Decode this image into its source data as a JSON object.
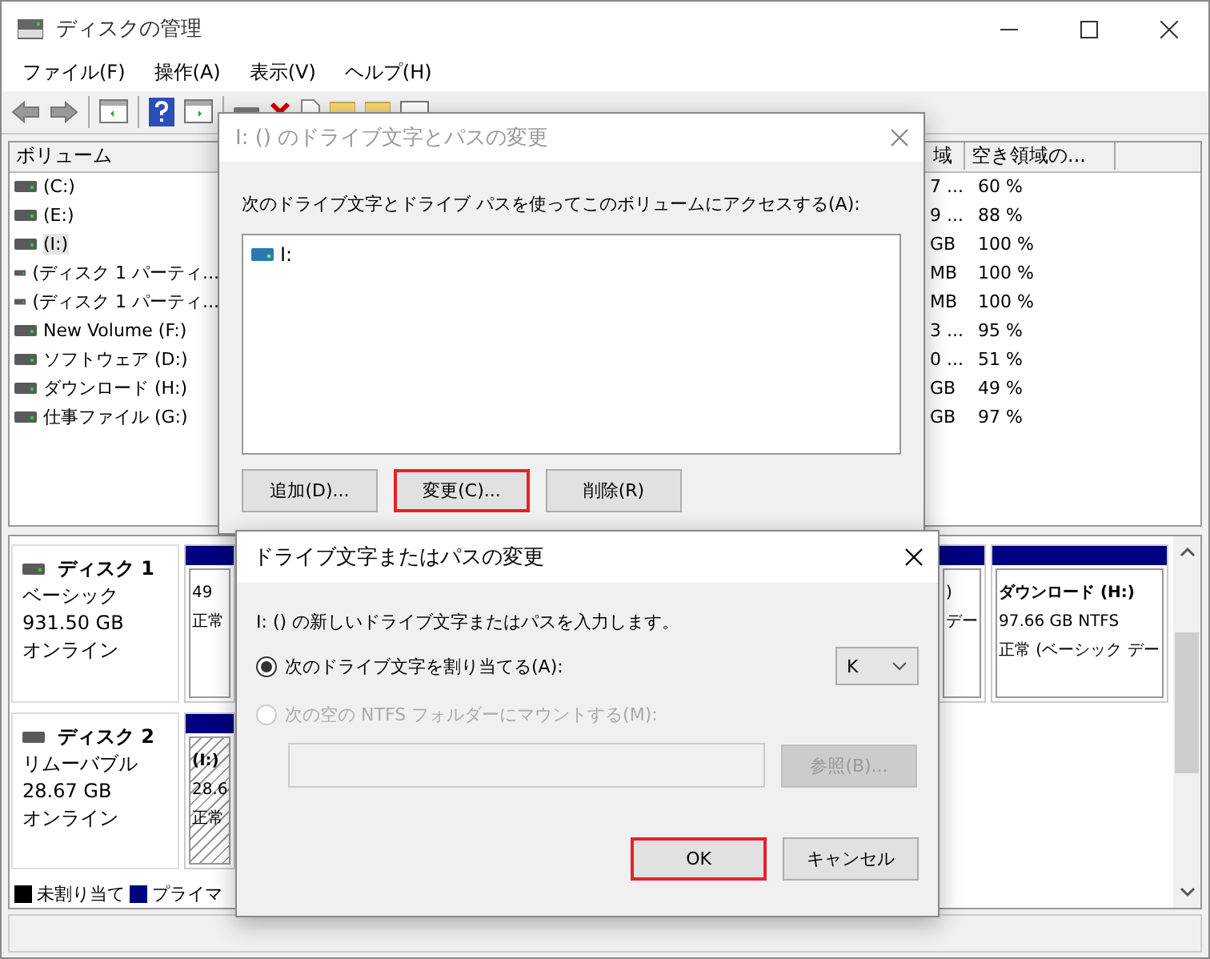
{
  "window": {
    "title": "ディスクの管理"
  },
  "menu": [
    {
      "label": "ファイル(F)"
    },
    {
      "label": "操作(A)"
    },
    {
      "label": "表示(V)"
    },
    {
      "label": "ヘルプ(H)"
    }
  ],
  "volume_table": {
    "columns": [
      {
        "label": "ボリューム"
      },
      {
        "label": "域"
      },
      {
        "label": "空き領域の..."
      }
    ],
    "rows": [
      {
        "volume": "(C:)",
        "column_2": "7 ...",
        "free": "60 %",
        "selected": false
      },
      {
        "volume": "(E:)",
        "column_2": "9 ...",
        "free": "88 %",
        "selected": false
      },
      {
        "volume": "(I:)",
        "column_2": "GB",
        "free": "100 %",
        "selected": true
      },
      {
        "volume": "(ディスク 1 パーティ...",
        "column_2": "MB",
        "free": "100 %",
        "selected": false
      },
      {
        "volume": "(ディスク 1 パーティ...",
        "column_2": "MB",
        "free": "100 %",
        "selected": false
      },
      {
        "volume": "New Volume (F:)",
        "column_2": "3 ...",
        "free": "95 %",
        "selected": false
      },
      {
        "volume": "ソフトウェア (D:)",
        "column_2": "0 ...",
        "free": "51 %",
        "selected": false
      },
      {
        "volume": "ダウンロード (H:)",
        "column_2": "GB",
        "free": "49 %",
        "selected": false
      },
      {
        "volume": "仕事ファイル (G:)",
        "column_2": "GB",
        "free": "97 %",
        "selected": false
      }
    ]
  },
  "disks": [
    {
      "name": "ディスク 1",
      "type": "ベーシック",
      "size": "931.50 GB",
      "status": "オンライン",
      "partitions": [
        {
          "lines": [
            "49",
            "正常"
          ],
          "selected": false
        },
        {
          "lines": [
            ")",
            "デー"
          ],
          "selected": false
        },
        {
          "title": "ダウンロード (H:)",
          "lines": [
            "97.66 GB NTFS",
            "正常 (ベーシック デー"
          ],
          "selected": false
        }
      ]
    },
    {
      "name": "ディスク 2",
      "type": "リムーバブル",
      "size": "28.67 GB",
      "status": "オンライン",
      "partitions": [
        {
          "title": "(I:)",
          "lines": [
            "28.6",
            "正常"
          ],
          "selected": true
        }
      ]
    }
  ],
  "legend": [
    {
      "label": "未割り当て",
      "color": "#000000"
    },
    {
      "label": "プライマ",
      "color": "#000080"
    }
  ],
  "path_dialog": {
    "title": "I: () のドライブ文字とパスの変更",
    "active": false,
    "prompt": "次のドライブ文字とドライブ パスを使ってこのボリュームにアクセスする(A):",
    "paths": [
      {
        "label": "I:"
      }
    ],
    "buttons": [
      {
        "label": "追加(D)...",
        "highlighted": false
      },
      {
        "label": "変更(C)...",
        "highlighted": true
      },
      {
        "label": "削除(R)",
        "highlighted": false
      }
    ]
  },
  "change_dialog": {
    "title": "ドライブ文字またはパスの変更",
    "prompt": "I: () の新しいドライブ文字またはパスを入力します。",
    "options": [
      {
        "label": "次のドライブ文字を割り当てる(A):",
        "selected": true,
        "disabled": false
      },
      {
        "label": "次の空の NTFS フォルダーにマウントする(M):",
        "selected": false,
        "disabled": true
      }
    ],
    "drive_letter": "K",
    "folder_field": {
      "disabled": true
    },
    "browse_button": {
      "label": "参照(B)...",
      "disabled": true
    },
    "buttons": [
      {
        "label": "OK",
        "highlighted": true
      },
      {
        "label": "キャンセル",
        "highlighted": false
      }
    ]
  }
}
